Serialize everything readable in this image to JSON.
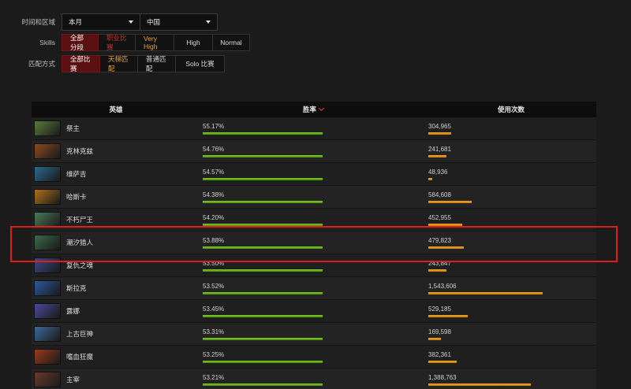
{
  "filters": {
    "time_region_label": "时间和区域",
    "time_value": "本月",
    "region_value": "中国",
    "skills_label": "Skills",
    "skills_options": [
      "全部分段",
      "职业比赛",
      "Very High",
      "High",
      "Normal"
    ],
    "match_type_label": "匹配方式",
    "match_options": [
      "全部比赛",
      "天梯匹配",
      "普通匹配",
      "Solo 比赛"
    ]
  },
  "table": {
    "headers": {
      "hero": "英雄",
      "winrate": "胜率",
      "usage": "使用次数"
    },
    "rows": [
      {
        "name": "祭主",
        "winrate": "55.17%",
        "usage": "304,965",
        "usage_num": 304965,
        "win_fill": 1.0,
        "portrait_color": "#5a7a3a"
      },
      {
        "name": "克林克兹",
        "winrate": "54.76%",
        "usage": "241,681",
        "usage_num": 241681,
        "win_fill": 1.0,
        "portrait_color": "#8a4a20"
      },
      {
        "name": "维萨吉",
        "winrate": "54.57%",
        "usage": "48,936",
        "usage_num": 48936,
        "win_fill": 1.0,
        "portrait_color": "#2a6a8a"
      },
      {
        "name": "哈斯卡",
        "winrate": "54.38%",
        "usage": "584,608",
        "usage_num": 584608,
        "win_fill": 1.0,
        "portrait_color": "#b0701a"
      },
      {
        "name": "不朽尸王",
        "winrate": "54.20%",
        "usage": "452,955",
        "usage_num": 452955,
        "win_fill": 1.0,
        "portrait_color": "#4a7a5a"
      },
      {
        "name": "潮汐猎人",
        "winrate": "53.88%",
        "usage": "479,823",
        "usage_num": 479823,
        "win_fill": 1.0,
        "portrait_color": "#3a6a4a"
      },
      {
        "name": "复仇之魂",
        "winrate": "53.50%",
        "usage": "243,847",
        "usage_num": 243847,
        "win_fill": 1.0,
        "portrait_color": "#3a4a8a"
      },
      {
        "name": "斯拉克",
        "winrate": "53.52%",
        "usage": "1,543,606",
        "usage_num": 1543606,
        "win_fill": 1.0,
        "portrait_color": "#2a5a9a"
      },
      {
        "name": "露娜",
        "winrate": "53.45%",
        "usage": "529,185",
        "usage_num": 529185,
        "win_fill": 1.0,
        "portrait_color": "#4a4a9a"
      },
      {
        "name": "上古巨神",
        "winrate": "53.31%",
        "usage": "169,598",
        "usage_num": 169598,
        "win_fill": 1.0,
        "portrait_color": "#3a6a9a"
      },
      {
        "name": "嗜血狂魔",
        "winrate": "53.25%",
        "usage": "382,361",
        "usage_num": 382361,
        "win_fill": 1.0,
        "portrait_color": "#9a3a1a"
      },
      {
        "name": "主宰",
        "winrate": "53.21%",
        "usage": "1,388,763",
        "usage_num": 1388763,
        "win_fill": 1.0,
        "portrait_color": "#6a3a2a"
      }
    ]
  },
  "colors": {
    "active_bg": "#5a1010",
    "win_bar": "#7ed321",
    "usage_bar": "#f5a623",
    "highlight": "#e01c1c"
  }
}
